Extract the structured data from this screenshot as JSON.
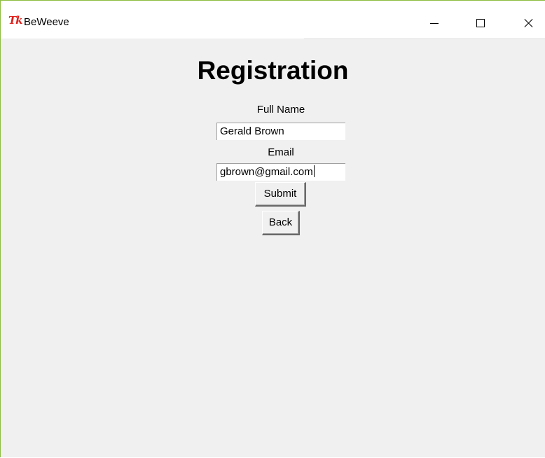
{
  "window": {
    "title": "BeWeeve",
    "logo_text": "Tk",
    "accent_border": "#8cbd3f",
    "controls": {
      "minimize": "minimize-icon",
      "maximize": "maximize-icon",
      "close": "close-icon"
    }
  },
  "form": {
    "heading": "Registration",
    "full_name_label": "Full Name",
    "full_name_value": "Gerald Brown",
    "email_label": "Email",
    "email_value": "gbrown@gmail.com",
    "submit_label": "Submit",
    "back_label": "Back"
  }
}
